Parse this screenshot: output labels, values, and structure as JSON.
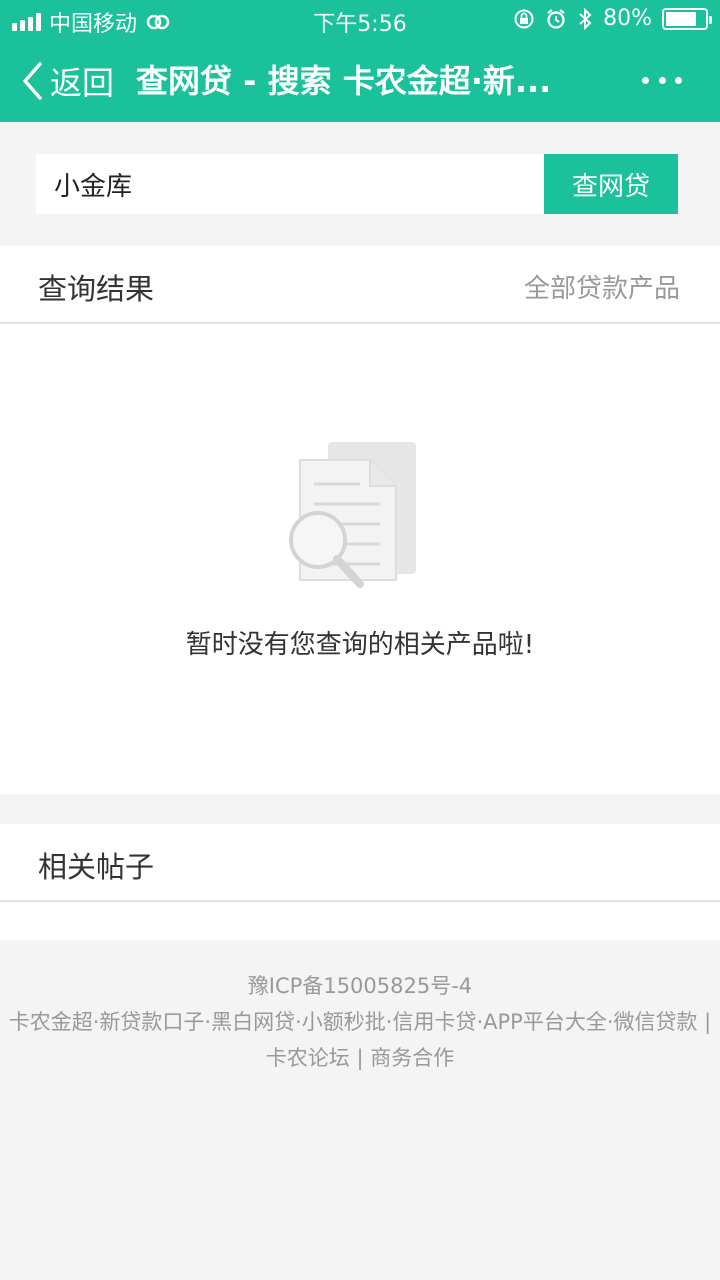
{
  "status_bar": {
    "carrier": "中国移动",
    "time": "下午5:56",
    "battery": "80%"
  },
  "nav": {
    "back_label": "返回",
    "title": "查网贷 - 搜索 卡农金超·新..."
  },
  "search": {
    "value": "小金库",
    "button_label": "查网贷"
  },
  "results": {
    "title": "查询结果",
    "all_products_link": "全部贷款产品",
    "empty_message": "暂时没有您查询的相关产品啦!"
  },
  "posts": {
    "title": "相关帖子"
  },
  "footer": {
    "icp": "豫ICP备15005825号-4",
    "links_text": "卡农金超·新贷款口子·黑白网贷·小额秒批·信用卡贷·APP平台大全·微信贷款 | 卡农论坛 | 商务合作"
  },
  "colors": {
    "brand": "#1bc19b",
    "background": "#f4f4f4"
  },
  "battery_level": 0.8
}
